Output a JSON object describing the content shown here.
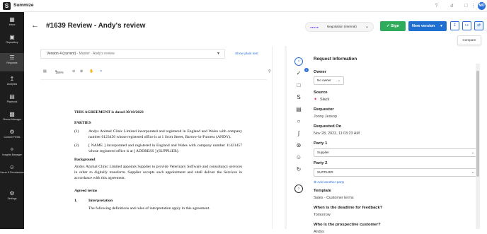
{
  "app": {
    "brand": "Summize",
    "logo": "S",
    "avatar_initials": "MO"
  },
  "topbar": {
    "icons": [
      "help-icon",
      "bell-icon",
      "inbox-icon",
      "grid-icon"
    ]
  },
  "sidebar": {
    "items": [
      {
        "label": "Inbox",
        "icon": "inbox-icon"
      },
      {
        "label": "Repository",
        "icon": "repository-icon"
      },
      {
        "label": "Requests",
        "icon": "requests-icon",
        "active": true
      },
      {
        "label": "Analytics",
        "icon": "analytics-icon"
      },
      {
        "label": "Playbook",
        "icon": "playbook-icon"
      },
      {
        "label": "Clause Manager",
        "icon": "clause-icon"
      },
      {
        "label": "Custom Fields",
        "icon": "custom-fields-icon"
      },
      {
        "label": "Insights Manager",
        "icon": "insights-icon"
      },
      {
        "label": "Users & Permissions",
        "icon": "users-icon"
      },
      {
        "label": "Settings",
        "icon": "settings-icon"
      }
    ]
  },
  "header": {
    "title": "#1639 Review - Andy's review",
    "stage": "Negotiation (internal)",
    "sign": "Sign",
    "new_version": "New version",
    "tooltip": "Compare"
  },
  "document": {
    "version_select": {
      "label": "Version 4 (current)",
      "sub": " - Master · Andy's review"
    },
    "show_plain_text": "Show plain text",
    "zoom": "156%",
    "heading": "THIS AGREEMENT is dated 30/10/2023",
    "parties_heading": "PARTIES",
    "p1_num": "(1)",
    "p1": "Andys Animal Clinic Limited incorporated and registered in England and Wales with company number 0123456 whose registered office is at 1 Scott Street, Barrow-in-Furness (ANDY).",
    "p2_num": "(2)",
    "p2": "[        NAME        ] incorporated and registered in England and Wales with company number 11421457 whose registered office is at [     ADDRESS     ] (SUPPLIER).",
    "background_heading": "Background",
    "background": "Andys Animal Clinic Limited appoints Supplier to provide Veterinary Software and consultancy services in order to digitally transform. Supplier accepts such appointment and shall deliver the Services in accordance with this agreement.",
    "agreed_terms": "Agreed terms",
    "interp_num": "1.",
    "interp_heading": "Interpretation",
    "interp_text": "The following definitions and rules of interpretation apply in this agreement."
  },
  "panel": {
    "title": "Request Information",
    "owner_label": "Owner",
    "owner_value": "No owner",
    "source_label": "Source",
    "source_value": "Slack",
    "requestor_label": "Requestor",
    "requestor_value": "Jonny Jessop",
    "requested_on_label": "Requested On",
    "requested_on_value": "Nov 28, 2023, 11:03:23 AM",
    "party1_label": "Party 1",
    "party1_value": "Supplier",
    "party2_label": "Party 2",
    "party2_value": "SUPPLIER",
    "add_party": "Add another party",
    "template_label": "Template",
    "template_value": "Sales - Customer terms",
    "deadline_label": "When is the deadline for feedback?",
    "deadline_value": "Tomorrow",
    "customer_label": "Who is the prospective customer?",
    "customer_value": "Andys"
  },
  "colors": {
    "sidebar": "#1d1d1d",
    "primary": "#1f6fd1",
    "sign": "#2eab5b"
  }
}
